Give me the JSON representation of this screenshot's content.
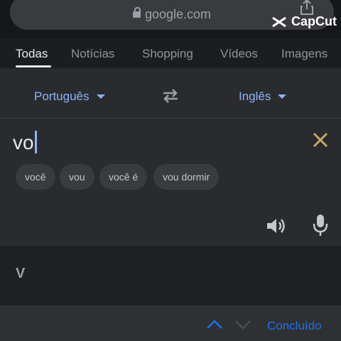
{
  "browser": {
    "url": "google.com",
    "overlay_brand": "CapCut"
  },
  "tabs": [
    {
      "label": "Todas",
      "active": true
    },
    {
      "label": "Notícias"
    },
    {
      "label": "Shopping"
    },
    {
      "label": "Vídeos"
    },
    {
      "label": "Imagens"
    }
  ],
  "translator": {
    "source_lang": "Português",
    "target_lang": "Inglês",
    "input_value": "vo",
    "suggestions": [
      "você",
      "vou",
      "você é",
      "vou dormir"
    ],
    "result": "V"
  },
  "keyboard_toolbar": {
    "done_label": "Concluído"
  },
  "colors": {
    "accent": "#8ab4f8",
    "clear": "#c8a86a",
    "done": "#1a73e8",
    "panel": "#2a2b2f"
  },
  "icons": [
    "lock-icon",
    "share-icon",
    "capcut-logo-icon",
    "swap-icon",
    "clear-icon",
    "speaker-icon",
    "mic-icon",
    "chevron-up-icon",
    "chevron-down-icon"
  ]
}
